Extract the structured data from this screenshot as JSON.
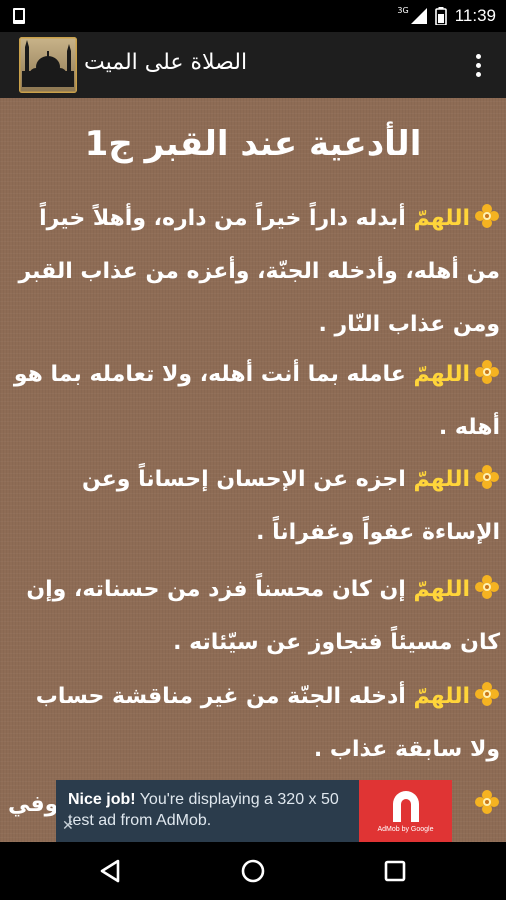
{
  "status_bar": {
    "time": "11:39",
    "network": "3G"
  },
  "app_bar": {
    "title": "الصلاة على الميت"
  },
  "content": {
    "heading": "الأدعية عند القبر ج1",
    "duas": [
      {
        "lead": "اللهمّ",
        "text": " أبدله داراً خيراً من داره، وأهلاً خيراً من أهله، وأدخله الجنّة، وأعزه من عذاب القبر ومن عذاب النّار ."
      },
      {
        "lead": "اللهمّ",
        "text": " عامله بما أنت أهله، ولا تعامله بما هو أهله ."
      },
      {
        "lead": "اللهمّ",
        "text": " اجزه عن الإحسان إحساناً وعن الإساءة عفواً وغفراناً ."
      },
      {
        "lead": "اللهمّ",
        "text": " إن كان محسناً فزد من حسناته، وإن كان مسيئاً فتجاوز عن سيّئاته ."
      },
      {
        "lead": "اللهمّ",
        "text": " أدخله الجنّة من غير مناقشة حساب ولا سابقة عذاب ."
      },
      {
        "lead": "",
        "text": "وفي"
      }
    ]
  },
  "ad": {
    "headline": "Nice job!",
    "body": " You're displaying a 320 x 50 test ad from AdMob.",
    "close": "✕",
    "brand": "AdMob by Google"
  },
  "colors": {
    "background": "#8e6c55",
    "accent": "#ffd53a",
    "app_bar": "#1e1e1e",
    "ad_red": "#e03434",
    "ad_dark": "#2b3c4c"
  },
  "icons": {
    "back": "back-triangle-icon",
    "home": "home-circle-icon",
    "recents": "recents-square-icon",
    "overflow": "overflow-menu-icon"
  }
}
